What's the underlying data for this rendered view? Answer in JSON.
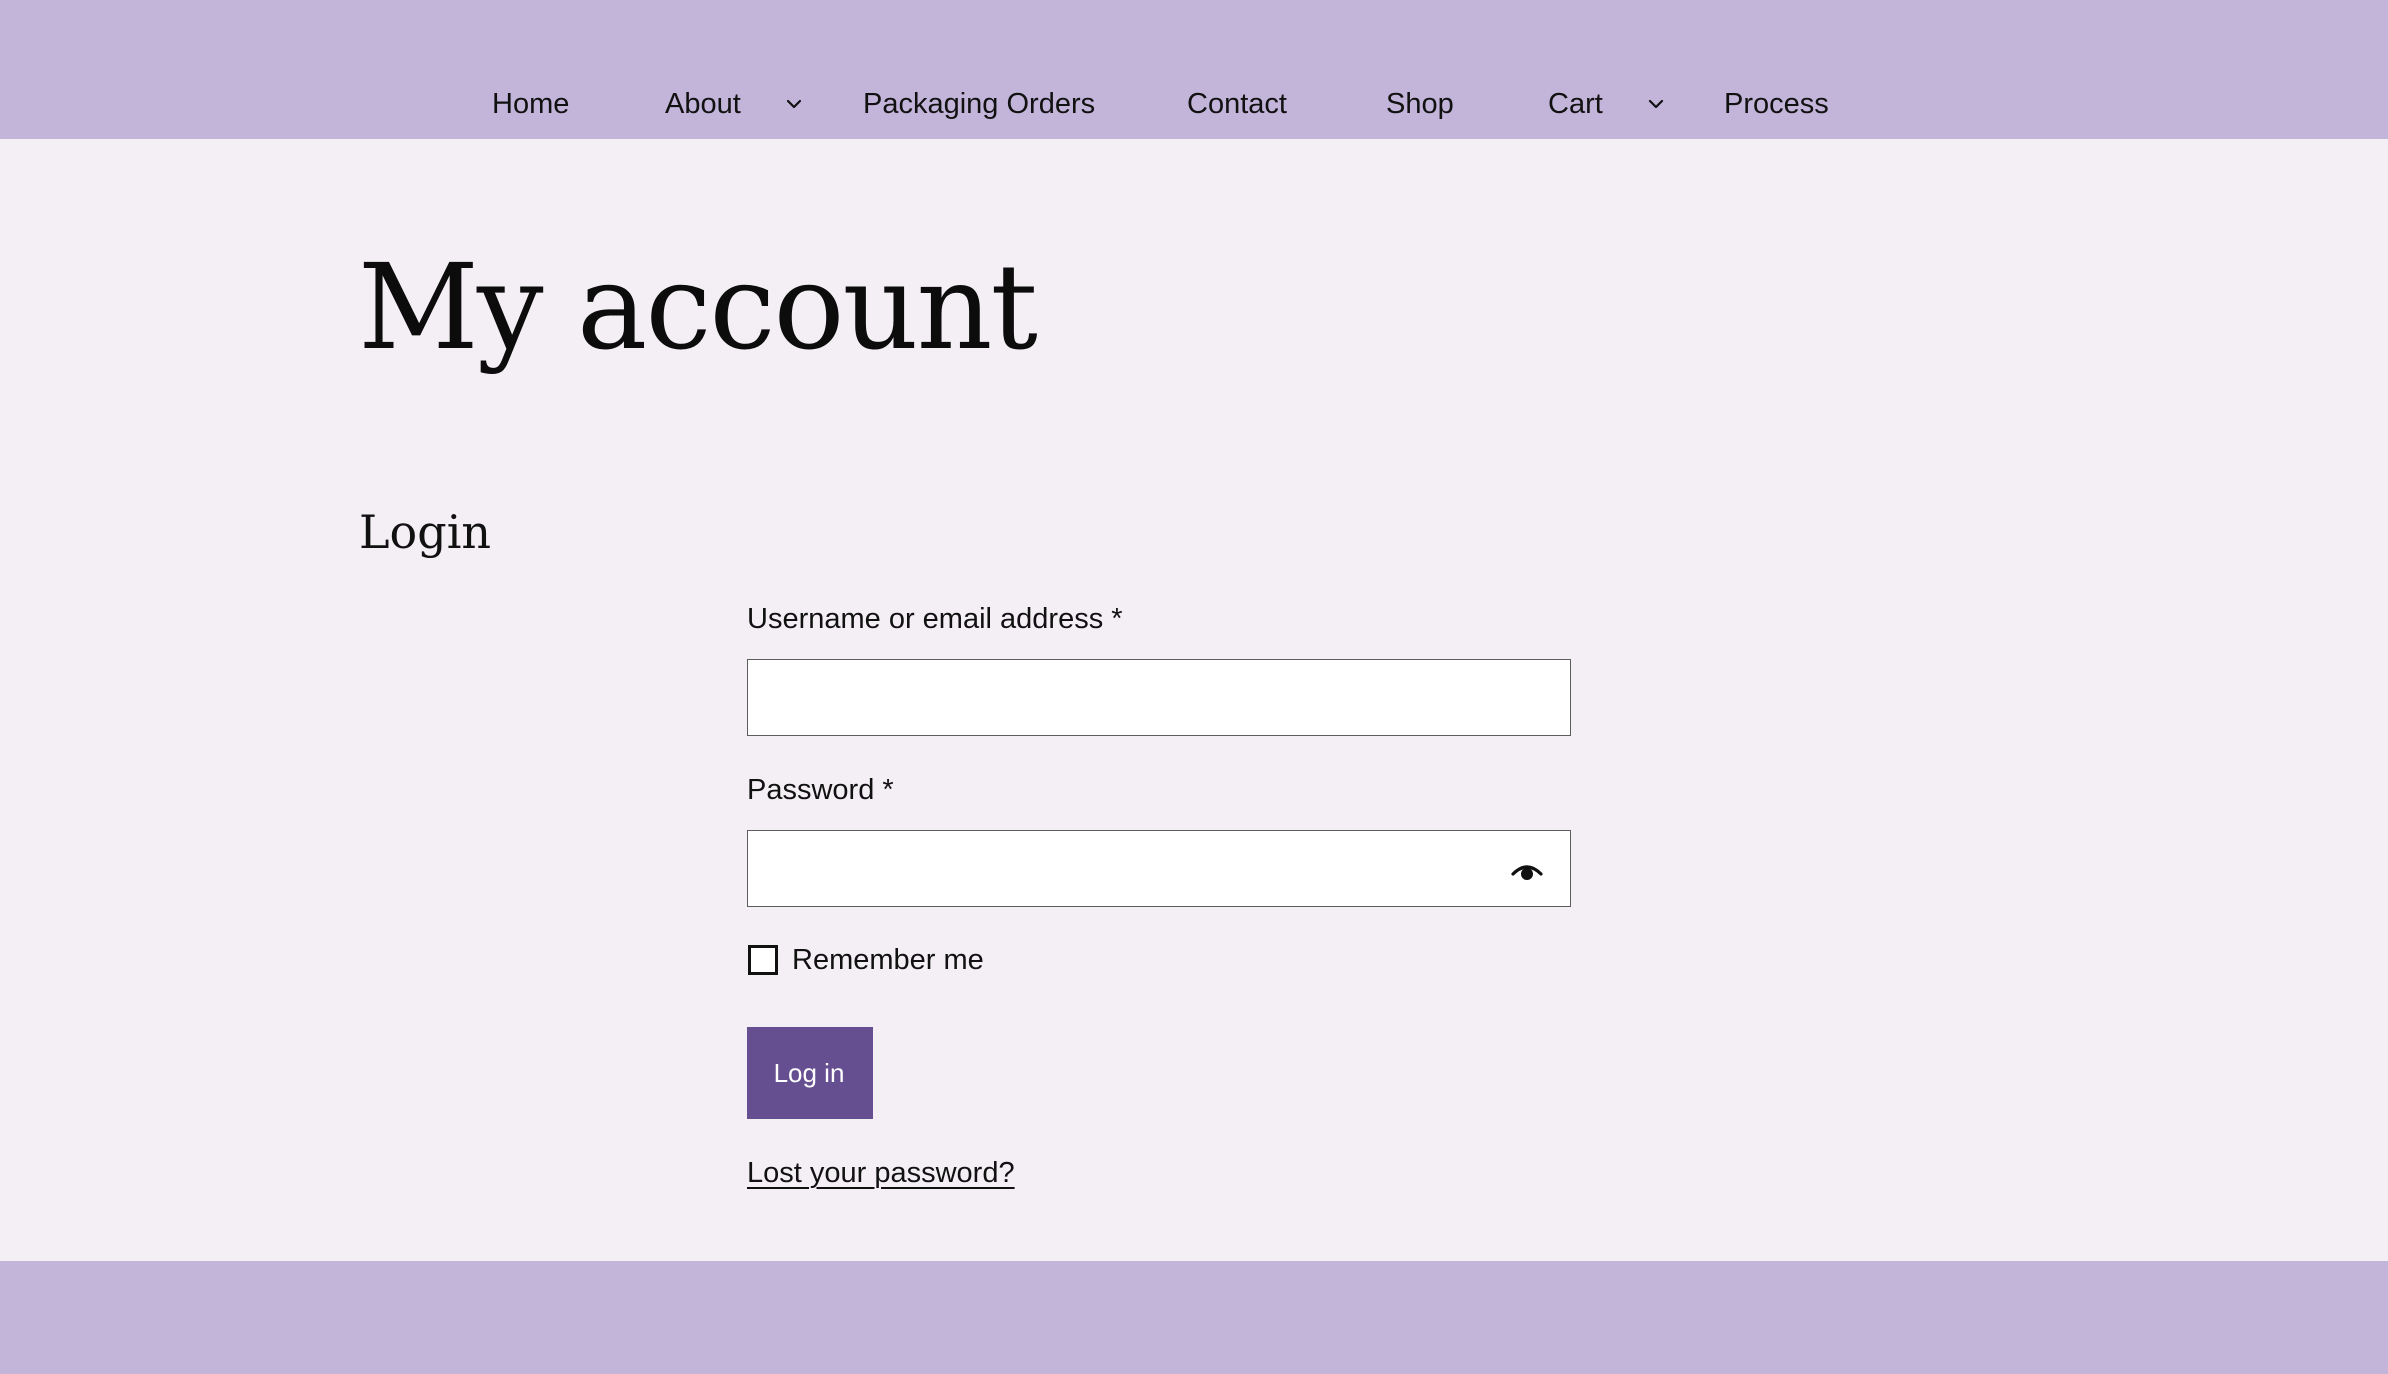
{
  "nav": {
    "items": [
      {
        "label": "Home"
      },
      {
        "label": "About",
        "has_submenu": true
      },
      {
        "label": "Packaging Orders"
      },
      {
        "label": "Contact"
      },
      {
        "label": "Shop"
      },
      {
        "label": "Cart",
        "has_submenu": true
      },
      {
        "label": "Process"
      }
    ],
    "submenu_icon": "chevron-down-icon"
  },
  "page": {
    "title": "My account"
  },
  "login": {
    "heading": "Login",
    "username_label": "Username or email address *",
    "username_value": "",
    "password_label": "Password *",
    "password_value": "",
    "show_password_icon": "eye-icon",
    "remember_label": "Remember me",
    "remember_checked": false,
    "submit_label": "Log in",
    "lost_password_label": "Lost your password?"
  },
  "colors": {
    "header_bg": "#c3b5da",
    "page_bg": "#f4eff5",
    "button_bg": "#654f91",
    "footer_bg": "#c3b5da"
  }
}
